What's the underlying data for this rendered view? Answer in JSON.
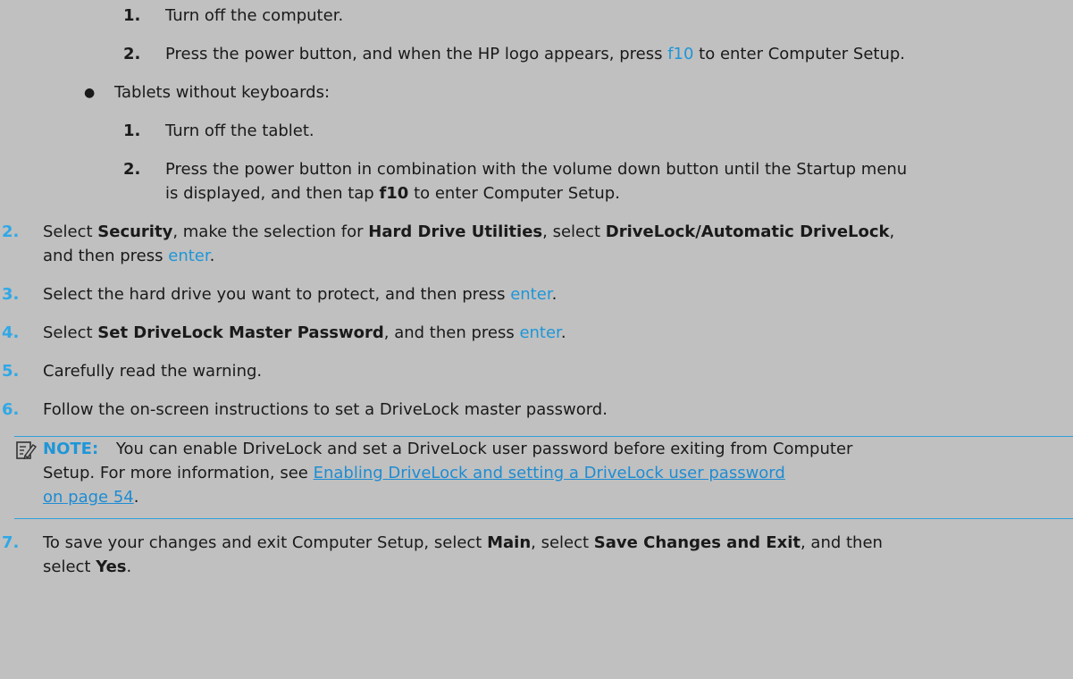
{
  "keyboard_steps": [
    {
      "num": "1.",
      "text": "Turn off the computer."
    },
    {
      "num": "2.",
      "pre": "Press the power button, and when the HP logo appears, press ",
      "key": "f10",
      "post": " to enter Computer Setup."
    }
  ],
  "tablets_bullet": {
    "glyph": "●",
    "text": "Tablets without keyboards:"
  },
  "tablet_steps": [
    {
      "num": "1.",
      "text": "Turn off the tablet."
    },
    {
      "num": "2.",
      "line1": "Press the power button in combination with the volume down button until the Startup menu",
      "line2_pre": "is displayed, and then tap ",
      "line2_bold": "f10",
      "line2_post": " to enter Computer Setup."
    }
  ],
  "step2": {
    "num": "2.",
    "a": "Select ",
    "b": "Security",
    "c": ", make the selection for ",
    "d": "Hard Drive Utilities",
    "e": ", select ",
    "f": "DriveLock/Automatic DriveLock",
    "g": ",",
    "line2_pre": "and then press ",
    "line2_key": "enter",
    "line2_post": "."
  },
  "step3": {
    "num": "3.",
    "pre": "Select the hard drive you want to protect, and then press ",
    "key": "enter",
    "post": "."
  },
  "step4": {
    "num": "4.",
    "pre": "Select ",
    "bold": "Set DriveLock Master Password",
    "mid": ", and then press ",
    "key": "enter",
    "post": "."
  },
  "step5": {
    "num": "5.",
    "text": "Carefully read the warning."
  },
  "step6": {
    "num": "6.",
    "text": "Follow the on-screen instructions to set a DriveLock master password."
  },
  "note": {
    "label": "NOTE:",
    "line1": "You can enable DriveLock and set a DriveLock user password before exiting from Computer",
    "line2_pre": "Setup. For more information, see ",
    "link1": "Enabling DriveLock and setting a DriveLock user password",
    "link2": "on page 54",
    "line3_post": "."
  },
  "step7": {
    "num": "7.",
    "a": "To save your changes and exit Computer Setup, select ",
    "b": "Main",
    "c": ", select ",
    "d": "Save Changes and Exit",
    "e": ", and then",
    "line2_pre": "select ",
    "line2_bold": "Yes",
    "line2_post": "."
  },
  "colors": {
    "accent": "#30a8e6",
    "link": "#1e8cd2",
    "background": "#c0c0c0"
  },
  "icons": {
    "note": "note-pencil-icon"
  }
}
